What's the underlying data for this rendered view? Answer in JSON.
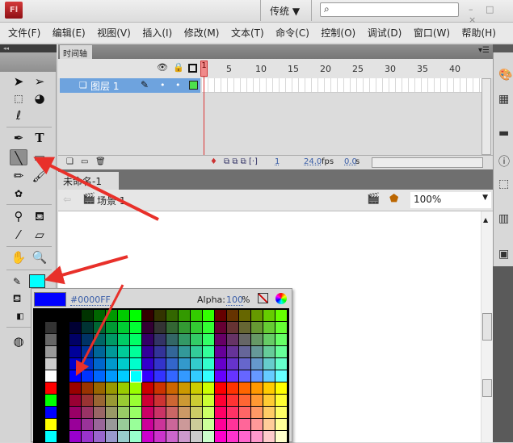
{
  "app": {
    "logo": "Fl",
    "workspace": "传统 ▼",
    "search_placeholder": "",
    "search_icon": "⌕",
    "window_controls": "– □ ×"
  },
  "menu": [
    "文件(F)",
    "编辑(E)",
    "视图(V)",
    "插入(I)",
    "修改(M)",
    "文本(T)",
    "命令(C)",
    "控制(O)",
    "调试(D)",
    "窗口(W)",
    "帮助(H)"
  ],
  "toolbox": {
    "collapse": "◂◂",
    "selected_tool": "line-tool",
    "stroke_color": "#00FFFF"
  },
  "timeline": {
    "tab": "时间轴",
    "frame_numbers": [
      "1",
      "5",
      "10",
      "15",
      "20",
      "25",
      "30",
      "35",
      "40"
    ],
    "layer": {
      "name": "图层 1",
      "pencil": "✎",
      "dot1": "•",
      "dot2": "•"
    },
    "current_frame": "1",
    "fps": "24.0",
    "fps_unit": "fps",
    "time": "0.0",
    "time_unit": "s"
  },
  "document": {
    "tab": "未命名-1",
    "close": "×",
    "scene": "场景 1",
    "zoom": "100%"
  },
  "color_popup": {
    "hex": "#0000FF",
    "preview_color": "#0000FF",
    "alpha_label": "Alpha:",
    "alpha_value": "100",
    "alpha_unit": "%",
    "selected_swatch": "#00FFFF",
    "levels": [
      "00",
      "33",
      "66",
      "99",
      "CC",
      "FF"
    ],
    "side_colors": [
      "#000000",
      "#333333",
      "#666666",
      "#999999",
      "#CCCCCC",
      "#FFFFFF",
      "#FF0000",
      "#00FF00",
      "#0000FF",
      "#FFFF00",
      "#00FFFF",
      "#FF00FF"
    ]
  },
  "annotation_color": "#E8302A"
}
